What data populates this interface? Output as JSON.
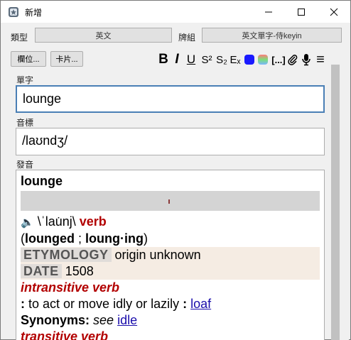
{
  "window": {
    "title": "新增",
    "controls": {
      "minimize": "—",
      "maximize": "☐",
      "close": "✕"
    }
  },
  "meta_row": {
    "type_label": "類型",
    "type_value": "英文",
    "deck_label": "牌組",
    "deck_value": "英文單字-侍keyin"
  },
  "toolbar": {
    "fields_button": "欄位...",
    "cards_button": "卡片...",
    "format_icons": [
      "bold-icon",
      "italic-icon",
      "underline-icon",
      "superscript-icon",
      "subscript-icon",
      "clear-format-icon",
      "text-color-icon",
      "highlight-icon",
      "cloze-icon",
      "attach-icon",
      "record-icon",
      "more-icon"
    ],
    "format_glyphs": {
      "bold": "B",
      "italic": "I",
      "underline": "U",
      "superscript": "S²",
      "subscript": "S₂",
      "clear": "Eₓ",
      "cloze": "[...]",
      "more": "≡"
    },
    "colors": {
      "text_color": "#1a1aff",
      "highlight": [
        "#ff7a7a",
        "#7adf7a",
        "#7ab6ff"
      ]
    }
  },
  "fields": {
    "word_label": "單字",
    "word_value": "lounge",
    "ipa_label": "音標",
    "ipa_value": "/laʊndʒ/",
    "pron_label": "發音"
  },
  "pronunciation": {
    "headword": "lounge",
    "speaker_glyph": "🔈",
    "phonetic": "\\ˈlau̇nj\\",
    "pos": "verb",
    "inflections": {
      "open": "(",
      "form1": "lounged",
      "sep": " ; ",
      "form2": "loung·ing",
      "close": ")"
    },
    "etymology_tag": "ETYMOLOGY",
    "etymology_text": "origin unknown",
    "date_tag": "DATE",
    "date_text": "1508",
    "sense1_label": "intransitive verb",
    "sense1_colon": ":",
    "sense1_text": "to act or move idly or lazily",
    "sense1_colon2": ":",
    "sense1_link": "loaf",
    "synonyms_label": "Synonyms:",
    "synonyms_see": "see",
    "synonyms_link": "idle",
    "sense2_label": "transitive verb"
  }
}
